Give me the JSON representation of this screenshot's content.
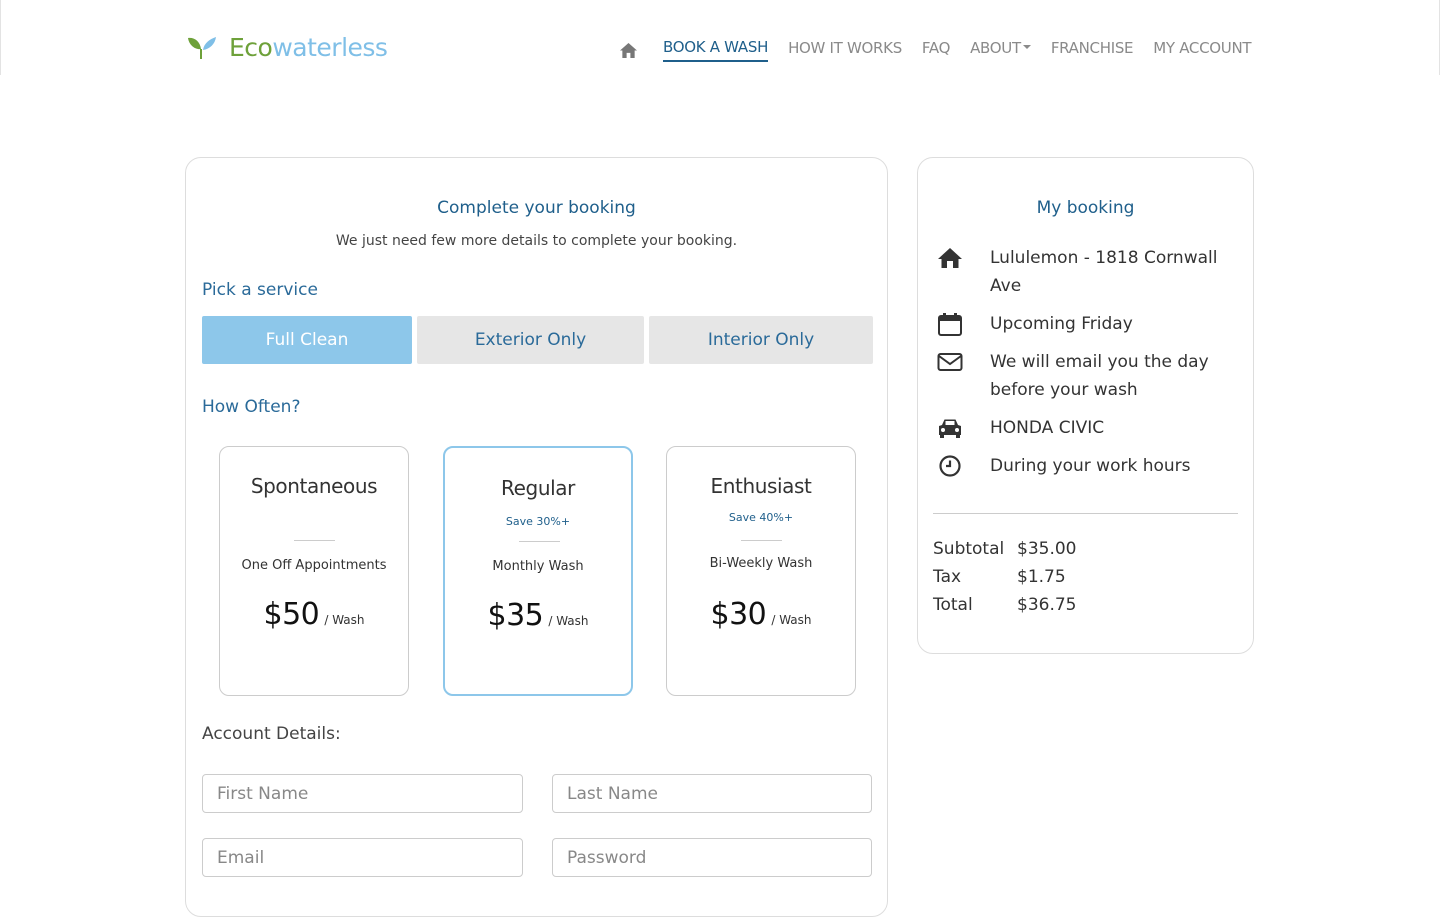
{
  "header": {
    "logo": {
      "part1": "Eco",
      "part2": "waterless"
    },
    "nav": {
      "home_icon": "home-icon",
      "items": [
        {
          "label": "BOOK A WASH",
          "active": true
        },
        {
          "label": "HOW IT WORKS"
        },
        {
          "label": "FAQ"
        },
        {
          "label": "ABOUT",
          "dropdown": true
        },
        {
          "label": "FRANCHISE"
        },
        {
          "label": "MY ACCOUNT"
        }
      ]
    }
  },
  "booking": {
    "title": "Complete your booking",
    "subtitle": "We just need few more details to complete your booking.",
    "pick_service_label": "Pick a service",
    "services": [
      {
        "label": "Full Clean",
        "selected": true
      },
      {
        "label": "Exterior Only"
      },
      {
        "label": "Interior Only"
      }
    ],
    "how_often_label": "How Often?",
    "plans": [
      {
        "name": "Spontaneous",
        "save": "",
        "desc": "One Off Appointments",
        "price": "$50",
        "unit": "/ Wash"
      },
      {
        "name": "Regular",
        "save": "Save 30%+",
        "desc": "Monthly Wash",
        "price": "$35",
        "unit": "/ Wash",
        "selected": true
      },
      {
        "name": "Enthusiast",
        "save": "Save 40%+",
        "desc": "Bi-Weekly Wash",
        "price": "$30",
        "unit": "/ Wash"
      }
    ],
    "account_label": "Account Details:",
    "fields": {
      "first_name": {
        "placeholder": "First Name"
      },
      "last_name": {
        "placeholder": "Last Name"
      },
      "email": {
        "placeholder": "Email"
      },
      "password": {
        "placeholder": "Password"
      }
    }
  },
  "summary": {
    "title": "My booking",
    "items": [
      {
        "icon": "home-icon",
        "text": "Lululemon - 1818 Cornwall Ave"
      },
      {
        "icon": "calendar-icon",
        "text": "Upcoming Friday"
      },
      {
        "icon": "envelope-icon",
        "text": "We will email you the day before your wash"
      },
      {
        "icon": "car-icon",
        "text": "HONDA CIVIC"
      },
      {
        "icon": "clock-icon",
        "text": "During your work hours"
      }
    ],
    "totals": [
      {
        "label": "Subtotal",
        "value": "$35.00"
      },
      {
        "label": "Tax",
        "value": "$1.75"
      },
      {
        "label": "Total",
        "value": "$36.75"
      }
    ]
  },
  "colors": {
    "accent": "#1f5f8b",
    "selected_fill": "#8dc7ea",
    "logo_green": "#6ea13a",
    "logo_blue": "#7fbfe7"
  }
}
